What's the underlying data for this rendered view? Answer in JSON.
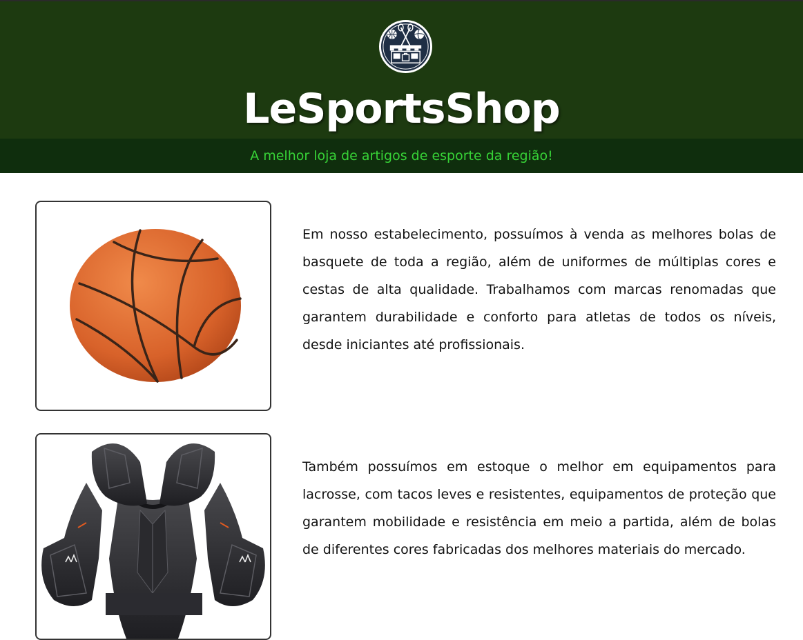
{
  "header": {
    "brand": "LeSportsShop",
    "tagline": "A melhor loja de artigos de esporte da região!",
    "logo_icon": "sports-shop-logo-icon",
    "colors": {
      "header_bg": "#1d3a10",
      "tagline_bg": "#0f2e0d",
      "tagline_text": "#37d337"
    }
  },
  "sections": [
    {
      "image_icon": "basketball-image",
      "text": "Em nosso estabelecimento, possuímos à venda as melhores bolas de basquete de toda a região, além de uniformes de múltiplas cores e cestas de alta qualidade. Trabalhamos com marcas renomadas que garantem durabilidade e conforto para atletas de todos os níveis, desde iniciantes até profissionais."
    },
    {
      "image_icon": "lacrosse-shoulder-pads-image",
      "text": "Também possuímos em estoque o melhor em equipamentos para lacrosse, com tacos leves e resistentes, equipamentos de proteção que garantem mobilidade e resistência em meio a partida, além de bolas de diferentes cores fabricadas dos melhores materiais do mercado."
    }
  ]
}
